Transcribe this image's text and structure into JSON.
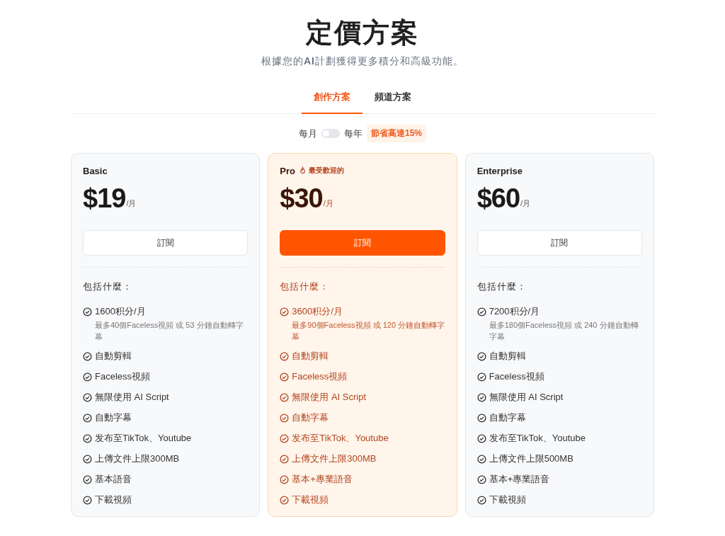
{
  "title": "定價方案",
  "subtitle": "根據您的**AI**計劃獲得更多積分和高級功能。",
  "tabs": [
    {
      "label": "創作方案",
      "selected": true
    },
    {
      "label": "頻道方案",
      "selected": false
    }
  ],
  "billing": {
    "monthly_label": "每月",
    "yearly_label": "每年",
    "on": false,
    "badge": "節省高達15%"
  },
  "plans": [
    {
      "name": "Basic",
      "featured": false,
      "price": "$19",
      "period": "/月",
      "button": "訂閱",
      "includes": "包括什麼：",
      "features": [
        {
          "text": "1600积分/月",
          "note": "最多40個Faceless視頻 或 53 分鐘自動轉字幕"
        },
        {
          "text": "自動剪輯"
        },
        {
          "text": "Faceless視頻"
        },
        {
          "text": "無限使用 AI Script"
        },
        {
          "text": "自動字幕"
        },
        {
          "text": "发布至TikTok、Youtube"
        },
        {
          "text": "上傳文件上限300MB"
        },
        {
          "text": "基本語音"
        },
        {
          "text": "下載視頻"
        }
      ]
    },
    {
      "name": "Pro",
      "featured": true,
      "badge": "最受歡迎的",
      "price": "$30",
      "period": "/月",
      "button": "訂閱",
      "includes": "包括什麼：",
      "features": [
        {
          "text": "3600积分/月",
          "note": "最多90個Faceless視頻 或 120 分鐘自動轉字幕"
        },
        {
          "text": "自動剪輯"
        },
        {
          "text": "Faceless視頻"
        },
        {
          "text": "無限使用 AI Script"
        },
        {
          "text": "自動字幕"
        },
        {
          "text": "发布至TikTok、Youtube"
        },
        {
          "text": "上傳文件上限300MB"
        },
        {
          "text": "基本+專業語音"
        },
        {
          "text": "下載視頻"
        }
      ]
    },
    {
      "name": "Enterprise",
      "featured": false,
      "price": "$60",
      "period": "/月",
      "button": "訂閱",
      "includes": "包括什麼：",
      "features": [
        {
          "text": "7200积分/月",
          "note": "最多180個Faceless視頻 或 240 分鐘自動轉字幕"
        },
        {
          "text": "自動剪輯"
        },
        {
          "text": "Faceless視頻"
        },
        {
          "text": "無限使用 AI Script"
        },
        {
          "text": "自動字幕"
        },
        {
          "text": "发布至TikTok、Youtube"
        },
        {
          "text": "上傳文件上限500MB"
        },
        {
          "text": "基本+專業語音"
        },
        {
          "text": "下載視頻"
        }
      ]
    }
  ]
}
